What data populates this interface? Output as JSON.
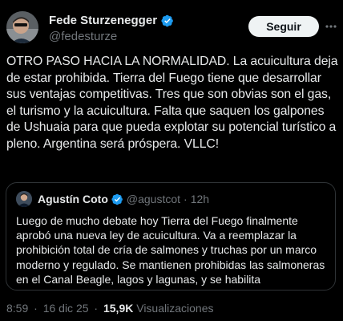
{
  "author": {
    "name": "Fede Sturzenegger",
    "handle": "@fedesturze",
    "verified": true
  },
  "actions": {
    "follow_label": "Seguir",
    "more_icon": "more-dots-icon"
  },
  "tweet": {
    "text": "OTRO PASO HACIA LA NORMALIDAD. La acuicultura deja de estar prohibida. Tierra del Fuego tiene que desarrollar sus ventajas competitivas. Tres que son obvias son el gas, el turismo y la acuicultura.  Falta que saquen los galpones de Ushuaia para que pueda explotar su potencial turístico a pleno. Argentina será próspera. VLLC!"
  },
  "quote": {
    "name": "Agustín Coto",
    "handle": "@agustcot",
    "separator": "·",
    "time": "12h",
    "verified": true,
    "text": "Luego de mucho debate hoy Tierra del Fuego finalmente aprobó una nueva ley de acuicultura. Va a reemplazar la prohibición total de cría de salmones y truchas por un marco moderno y regulado. Se mantienen prohibidas las salmoneras en el Canal Beagle, lagos y lagunas, y se habilita"
  },
  "footer": {
    "time": "8:59",
    "separator1": "·",
    "date": "16 dic 25",
    "separator2": "·",
    "views_count": "15,9K",
    "views_label": "Visualizaciones"
  },
  "colors": {
    "background": "#000000",
    "text": "#e7e9ea",
    "secondary": "#71767b",
    "verified_blue": "#1d9bf0",
    "border": "#2f3336"
  }
}
